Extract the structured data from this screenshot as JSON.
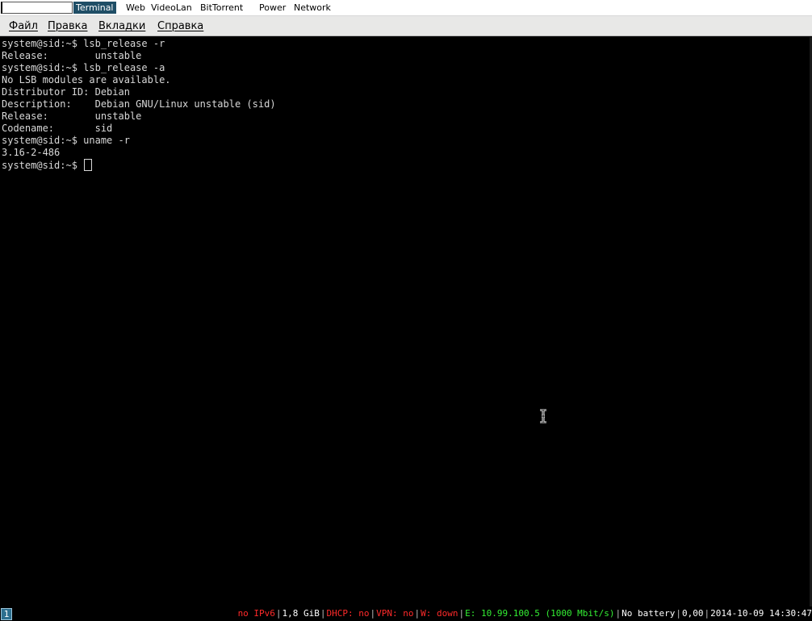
{
  "topbar": {
    "workspaces": [
      {
        "label": "Terminal",
        "active": true
      },
      {
        "label": "Web",
        "active": false
      },
      {
        "label": "VideoLan",
        "active": false
      },
      {
        "label": "BitTorrent",
        "active": false
      },
      {
        "label": "Power",
        "active": false
      },
      {
        "label": "Network",
        "active": false
      }
    ]
  },
  "menubar": {
    "items": [
      "Файл",
      "Правка",
      "Вкладки",
      "Справка"
    ]
  },
  "terminal": {
    "lines": [
      "system@sid:~$ lsb_release -r",
      "Release:        unstable",
      "system@sid:~$ lsb_release -a",
      "No LSB modules are available.",
      "Distributor ID: Debian",
      "Description:    Debian GNU/Linux unstable (sid)",
      "Release:        unstable",
      "Codename:       sid",
      "system@sid:~$ uname -r",
      "3.16-2-486"
    ],
    "prompt": "system@sid:~$ "
  },
  "statusbar": {
    "workspace_number": "1",
    "items": [
      {
        "text": "no IPv6",
        "color": "#ff2a2a"
      },
      {
        "text": "1,8 GiB",
        "color": "#ffffff"
      },
      {
        "text": "DHCP: no",
        "color": "#ff2a2a"
      },
      {
        "text": "VPN: no",
        "color": "#ff2a2a"
      },
      {
        "text": "W: down",
        "color": "#ff2a2a"
      },
      {
        "text": "E: 10.99.100.5 (1000 Mbit/s)",
        "color": "#33ee33"
      },
      {
        "text": "No battery",
        "color": "#ffffff"
      },
      {
        "text": "0,00",
        "color": "#ffffff"
      },
      {
        "text": "2014-10-09 14:30:47",
        "color": "#ffffff"
      }
    ]
  },
  "colors": {
    "active_workspace_bg": "#1f4e66",
    "terminal_bg": "#000000",
    "terminal_fg": "#d8d8d8",
    "status_alert": "#ff2a2a",
    "status_ok": "#33ee33"
  }
}
